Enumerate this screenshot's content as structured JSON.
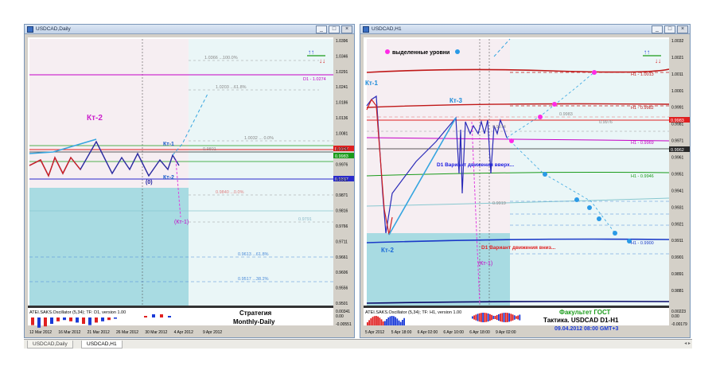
{
  "windows": {
    "left": {
      "title": "USDCAD,Daily"
    },
    "right": {
      "title": "USDCAD,H1"
    }
  },
  "window_buttons": {
    "minimize": "_",
    "restore": "□",
    "close": "×"
  },
  "left_chart": {
    "price_scale": [
      "1.0396",
      "1.0346",
      "1.0291",
      "1.0241",
      "1.0186",
      "1.0136",
      "1.0081",
      "1.0026",
      "0.9976",
      "0.9921",
      "0.9871",
      "0.9816",
      "0.9766",
      "0.9711",
      "0.9661",
      "0.9606",
      "0.9556",
      "0.9501"
    ],
    "price_badges": [
      "0.9987",
      "0.9983",
      "0.9887"
    ],
    "date_axis": [
      "12 Mar 2012",
      "16 Mar 2012",
      "21 Mar 2012",
      "26 Mar 2012",
      "30 Mar 2012",
      "4 Apr 2012",
      "9 Apr 2012"
    ],
    "labels": {
      "kt2_big": "Кт-2",
      "kt1": "Кт-1",
      "kt2_small": "Кт-2",
      "zero": "(0)",
      "kt1_paren": "(Кт-1)",
      "fibo_top": "1.0366 ...100.0%",
      "d1_line": "D1 - 1.0274",
      "fibo_b": "1.0203 ...61.8%",
      "fibo_c": "1.0032 ... 0.0%",
      "fibo_d": "0.9801",
      "fibo_e": "0.9840 ...0.0%",
      "fibo_f": "0.9791",
      "fibo_g": "0.9613 ...61.8%",
      "fibo_h": "0.9517 ...38.2%"
    },
    "oscillator": {
      "title": "ATEI.SAKS.Oscillator (5,34); TF: D1, version 1.00",
      "scale": [
        "0.00341",
        "0.00",
        "-0.00551"
      ]
    },
    "strategy": {
      "line1": "Стратегия",
      "line2": "Monthly-Daily"
    }
  },
  "right_chart": {
    "price_scale": [
      "1.0032",
      "1.0021",
      "1.0011",
      "1.0001",
      "0.9991",
      "0.9981",
      "0.9971",
      "0.9961",
      "0.9951",
      "0.9941",
      "0.9931",
      "0.9921",
      "0.9911",
      "0.9901",
      "0.9891",
      "0.9881"
    ],
    "price_badges": [
      "0.9983",
      "0.9962"
    ],
    "date_axis": [
      "5 Apr 2012",
      "5 Apr 18:00",
      "6 Apr 02:00",
      "6 Apr 10:00",
      "6 Apr 18:00",
      "9 Apr 02:00"
    ],
    "legend": "выделенные уровни",
    "labels": {
      "kt1": "Кт-1",
      "kt3": "Кт-3",
      "kt2": "Кт-2",
      "kt1_paren": "(Кт-1)",
      "d1_up": "D1 Вариант движения вверх...",
      "d1_down": "D1 Вариант движения вниз...",
      "h1_a": "H1 - 1.0013",
      "h1_b": "H1 - 0.9982",
      "h1_c": "H1 - 0.9969",
      "h1_d": "H1 - 0.9946",
      "h1_e": "H1 - 0.9900",
      "lvl_a": "0.9974",
      "lvl_b": "0.9983",
      "lvl_c": "0.9976",
      "lvl_d": "0.9919"
    },
    "oscillator": {
      "title": "ATEI.SAKS.Oscillator (5,34); TF: H1, version 1.00",
      "scale": [
        "0.00223",
        "0.00",
        "-0.00179"
      ]
    },
    "info": {
      "line1": "Факультет ГОСТ",
      "line2": "Тактика. USDCAD D1-H1",
      "line3": "09.04.2012 08:00 GMT+3"
    }
  },
  "tabs": [
    {
      "label": "USDCAD,Daily",
      "active": false
    },
    {
      "label": "USDCAD,H1",
      "active": true
    }
  ],
  "tab_arrows": "◂ ▸"
}
